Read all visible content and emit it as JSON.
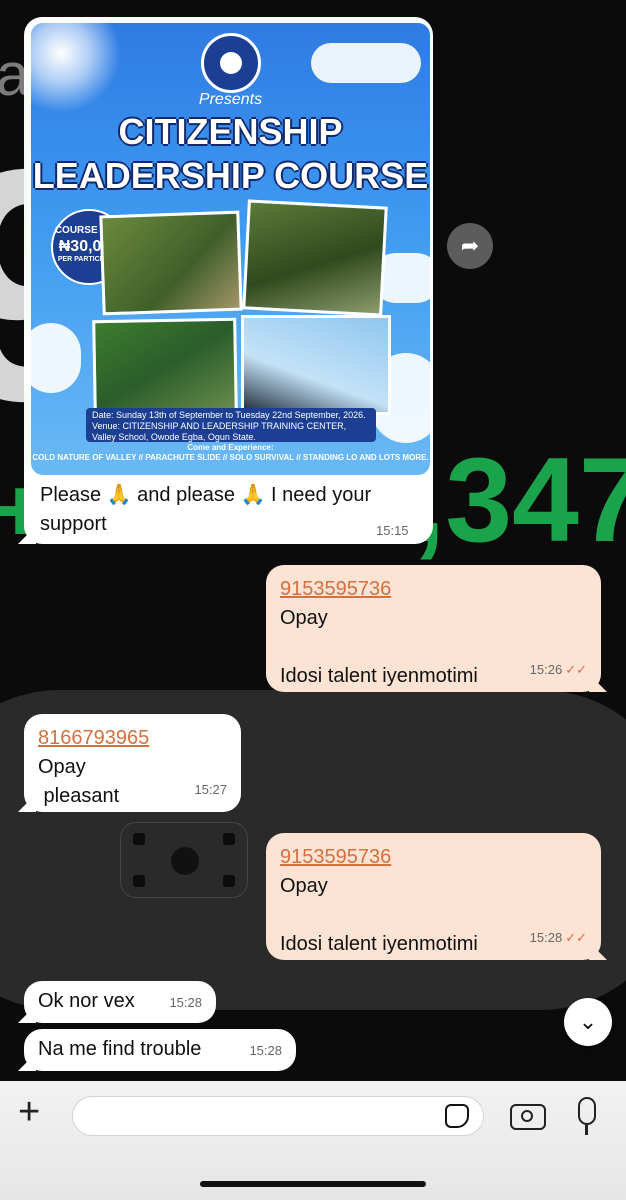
{
  "background": {
    "big_number": "98",
    "left_letter": "a",
    "green_text": ",347",
    "green_plus": "+"
  },
  "messages": [
    {
      "id": "m1",
      "direction": "incoming",
      "poster": {
        "presents": "Presents",
        "title_line1": "CITIZENSHIP",
        "title_line2": "LEADERSHIP COURSE",
        "fee_label": "COURSE FEE:",
        "fee_amount": "₦30,000",
        "fee_unit": "PER PARTICIPANT",
        "date_text": "Date: Sunday 13th of September to Tuesday 22nd September, 2026.",
        "venue_text": "Venue: CITIZENSHIP AND LEADERSHIP TRAINING CENTER, Valley School, Owode Egba, Ogun State.",
        "come_text": "Come and Experience:",
        "experience_text": "COLD NATURE OF VALLEY // PARACHUTE SLIDE // SOLO SURVIVAL // STANDING LO AND LOTS MORE."
      },
      "text_line1": "Please 🙏 and please 🙏 I need your",
      "text_line2": "support",
      "time": "15:15"
    },
    {
      "id": "m2",
      "direction": "outgoing",
      "phone": "9153595736",
      "line2": "Opay",
      "line3": "Idosi talent iyenmotimi",
      "time": "15:26"
    },
    {
      "id": "m3",
      "direction": "incoming",
      "phone": "8166793965",
      "line2": "Opay",
      "line3": " pleasant",
      "time": "15:27"
    },
    {
      "id": "m4",
      "direction": "outgoing",
      "phone": "9153595736",
      "line2": "Opay",
      "line3": "Idosi talent iyenmotimi",
      "time": "15:28"
    },
    {
      "id": "m5",
      "direction": "incoming",
      "text": "Ok nor vex",
      "time": "15:28"
    },
    {
      "id": "m6",
      "direction": "incoming",
      "text": "Na me find trouble",
      "time": "15:28"
    }
  ],
  "read_ticks": "✓✓",
  "icons": {
    "forward": "share-forward-icon",
    "scroll_down": "chevron-down-icon",
    "plus": "plus-icon",
    "sticker": "sticker-icon",
    "camera": "camera-icon",
    "mic": "microphone-icon"
  },
  "composer": {
    "placeholder": ""
  },
  "colors": {
    "outgoing_bubble": "#fde3d4",
    "incoming_bubble": "#ffffff",
    "phone_link": "#d4713e",
    "read_tick": "#e06a4b"
  }
}
